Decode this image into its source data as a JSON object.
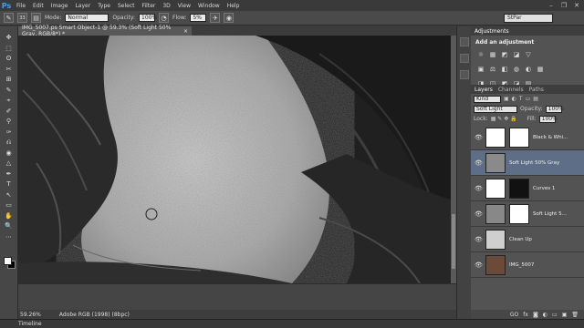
{
  "menubar": {
    "logo": "Ps",
    "items": [
      "File",
      "Edit",
      "Image",
      "Layer",
      "Type",
      "Select",
      "Filter",
      "3D",
      "View",
      "Window",
      "Help"
    ],
    "minimize": "–",
    "restore": "❐",
    "close": "✕"
  },
  "options": {
    "brush_size": "33",
    "mode_label": "Mode:",
    "mode_value": "Normal",
    "opacity_label": "Opacity:",
    "opacity_value": "100%",
    "flow_label": "Flow:",
    "flow_value": "5%",
    "workspace": "StPar"
  },
  "document": {
    "tab_title": "IMG_5007.ps Smart Object-1 @ 59.3% (Soft Light 50% Gray, RGB/8*) *",
    "tab_close": "×",
    "zoom": "59.26%",
    "profile": "Adobe RGB (1998) (8bpc)"
  },
  "timeline": {
    "tab": "Timeline"
  },
  "adjustments": {
    "tabs": [
      "Adjustments"
    ],
    "title": "Add an adjustment",
    "row1": [
      "☼",
      "▦",
      "◩",
      "◪",
      "▽"
    ],
    "row2": [
      "▣",
      "⚖",
      "◧",
      "◍",
      "◐",
      "▦"
    ],
    "row3": [
      "◨",
      "◫",
      "◩",
      "◪",
      "▨"
    ]
  },
  "layers": {
    "tabs": [
      "Layers",
      "Channels",
      "Paths"
    ],
    "filter": "Kind",
    "blend_mode": "Soft Light",
    "opacity_label": "Opacity:",
    "opacity_value": "100%",
    "lock_label": "Lock:",
    "fill_label": "Fill:",
    "fill_value": "100%",
    "items": [
      {
        "name": "Black & Whi...",
        "thumb": "#ffffff",
        "mask": "#ffffff"
      },
      {
        "name": "Soft Light 50% Gray",
        "thumb": "#8a8a8a",
        "mask": ""
      },
      {
        "name": "Curves 1",
        "thumb": "#ffffff",
        "mask": "#111111"
      },
      {
        "name": "Soft Light 5...",
        "thumb": "#888888",
        "mask": "#ffffff"
      },
      {
        "name": "Clean Up",
        "thumb": "#cfcfcf",
        "mask": ""
      },
      {
        "name": "IMG_5007",
        "thumb": "#6b4a3a",
        "mask": ""
      }
    ],
    "bottom_icons": [
      "GO",
      "fx",
      "◙",
      "◐",
      "▭",
      "▣",
      "🗑"
    ]
  },
  "tools": [
    "✥",
    "⬚",
    "ʘ",
    "✂",
    "⊞",
    "✎",
    "⌖",
    "✐",
    "⚲",
    "✑",
    "⎌",
    "◉",
    "△",
    "✒",
    "T",
    "↖",
    "▭",
    "✋",
    "🔍",
    "⋯",
    "▣",
    "▢"
  ]
}
